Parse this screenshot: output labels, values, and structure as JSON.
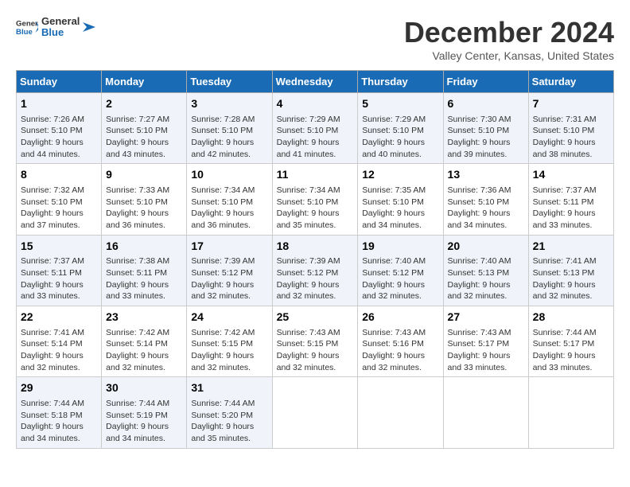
{
  "header": {
    "logo_line1": "General",
    "logo_line2": "Blue",
    "month_title": "December 2024",
    "location": "Valley Center, Kansas, United States"
  },
  "days_of_week": [
    "Sunday",
    "Monday",
    "Tuesday",
    "Wednesday",
    "Thursday",
    "Friday",
    "Saturday"
  ],
  "weeks": [
    [
      {
        "day": "1",
        "sunrise": "7:26 AM",
        "sunset": "5:10 PM",
        "daylight": "9 hours and 44 minutes."
      },
      {
        "day": "2",
        "sunrise": "7:27 AM",
        "sunset": "5:10 PM",
        "daylight": "9 hours and 43 minutes."
      },
      {
        "day": "3",
        "sunrise": "7:28 AM",
        "sunset": "5:10 PM",
        "daylight": "9 hours and 42 minutes."
      },
      {
        "day": "4",
        "sunrise": "7:29 AM",
        "sunset": "5:10 PM",
        "daylight": "9 hours and 41 minutes."
      },
      {
        "day": "5",
        "sunrise": "7:29 AM",
        "sunset": "5:10 PM",
        "daylight": "9 hours and 40 minutes."
      },
      {
        "day": "6",
        "sunrise": "7:30 AM",
        "sunset": "5:10 PM",
        "daylight": "9 hours and 39 minutes."
      },
      {
        "day": "7",
        "sunrise": "7:31 AM",
        "sunset": "5:10 PM",
        "daylight": "9 hours and 38 minutes."
      }
    ],
    [
      {
        "day": "8",
        "sunrise": "7:32 AM",
        "sunset": "5:10 PM",
        "daylight": "9 hours and 37 minutes."
      },
      {
        "day": "9",
        "sunrise": "7:33 AM",
        "sunset": "5:10 PM",
        "daylight": "9 hours and 36 minutes."
      },
      {
        "day": "10",
        "sunrise": "7:34 AM",
        "sunset": "5:10 PM",
        "daylight": "9 hours and 36 minutes."
      },
      {
        "day": "11",
        "sunrise": "7:34 AM",
        "sunset": "5:10 PM",
        "daylight": "9 hours and 35 minutes."
      },
      {
        "day": "12",
        "sunrise": "7:35 AM",
        "sunset": "5:10 PM",
        "daylight": "9 hours and 34 minutes."
      },
      {
        "day": "13",
        "sunrise": "7:36 AM",
        "sunset": "5:10 PM",
        "daylight": "9 hours and 34 minutes."
      },
      {
        "day": "14",
        "sunrise": "7:37 AM",
        "sunset": "5:11 PM",
        "daylight": "9 hours and 33 minutes."
      }
    ],
    [
      {
        "day": "15",
        "sunrise": "7:37 AM",
        "sunset": "5:11 PM",
        "daylight": "9 hours and 33 minutes."
      },
      {
        "day": "16",
        "sunrise": "7:38 AM",
        "sunset": "5:11 PM",
        "daylight": "9 hours and 33 minutes."
      },
      {
        "day": "17",
        "sunrise": "7:39 AM",
        "sunset": "5:12 PM",
        "daylight": "9 hours and 32 minutes."
      },
      {
        "day": "18",
        "sunrise": "7:39 AM",
        "sunset": "5:12 PM",
        "daylight": "9 hours and 32 minutes."
      },
      {
        "day": "19",
        "sunrise": "7:40 AM",
        "sunset": "5:12 PM",
        "daylight": "9 hours and 32 minutes."
      },
      {
        "day": "20",
        "sunrise": "7:40 AM",
        "sunset": "5:13 PM",
        "daylight": "9 hours and 32 minutes."
      },
      {
        "day": "21",
        "sunrise": "7:41 AM",
        "sunset": "5:13 PM",
        "daylight": "9 hours and 32 minutes."
      }
    ],
    [
      {
        "day": "22",
        "sunrise": "7:41 AM",
        "sunset": "5:14 PM",
        "daylight": "9 hours and 32 minutes."
      },
      {
        "day": "23",
        "sunrise": "7:42 AM",
        "sunset": "5:14 PM",
        "daylight": "9 hours and 32 minutes."
      },
      {
        "day": "24",
        "sunrise": "7:42 AM",
        "sunset": "5:15 PM",
        "daylight": "9 hours and 32 minutes."
      },
      {
        "day": "25",
        "sunrise": "7:43 AM",
        "sunset": "5:15 PM",
        "daylight": "9 hours and 32 minutes."
      },
      {
        "day": "26",
        "sunrise": "7:43 AM",
        "sunset": "5:16 PM",
        "daylight": "9 hours and 32 minutes."
      },
      {
        "day": "27",
        "sunrise": "7:43 AM",
        "sunset": "5:17 PM",
        "daylight": "9 hours and 33 minutes."
      },
      {
        "day": "28",
        "sunrise": "7:44 AM",
        "sunset": "5:17 PM",
        "daylight": "9 hours and 33 minutes."
      }
    ],
    [
      {
        "day": "29",
        "sunrise": "7:44 AM",
        "sunset": "5:18 PM",
        "daylight": "9 hours and 34 minutes."
      },
      {
        "day": "30",
        "sunrise": "7:44 AM",
        "sunset": "5:19 PM",
        "daylight": "9 hours and 34 minutes."
      },
      {
        "day": "31",
        "sunrise": "7:44 AM",
        "sunset": "5:20 PM",
        "daylight": "9 hours and 35 minutes."
      },
      null,
      null,
      null,
      null
    ]
  ]
}
